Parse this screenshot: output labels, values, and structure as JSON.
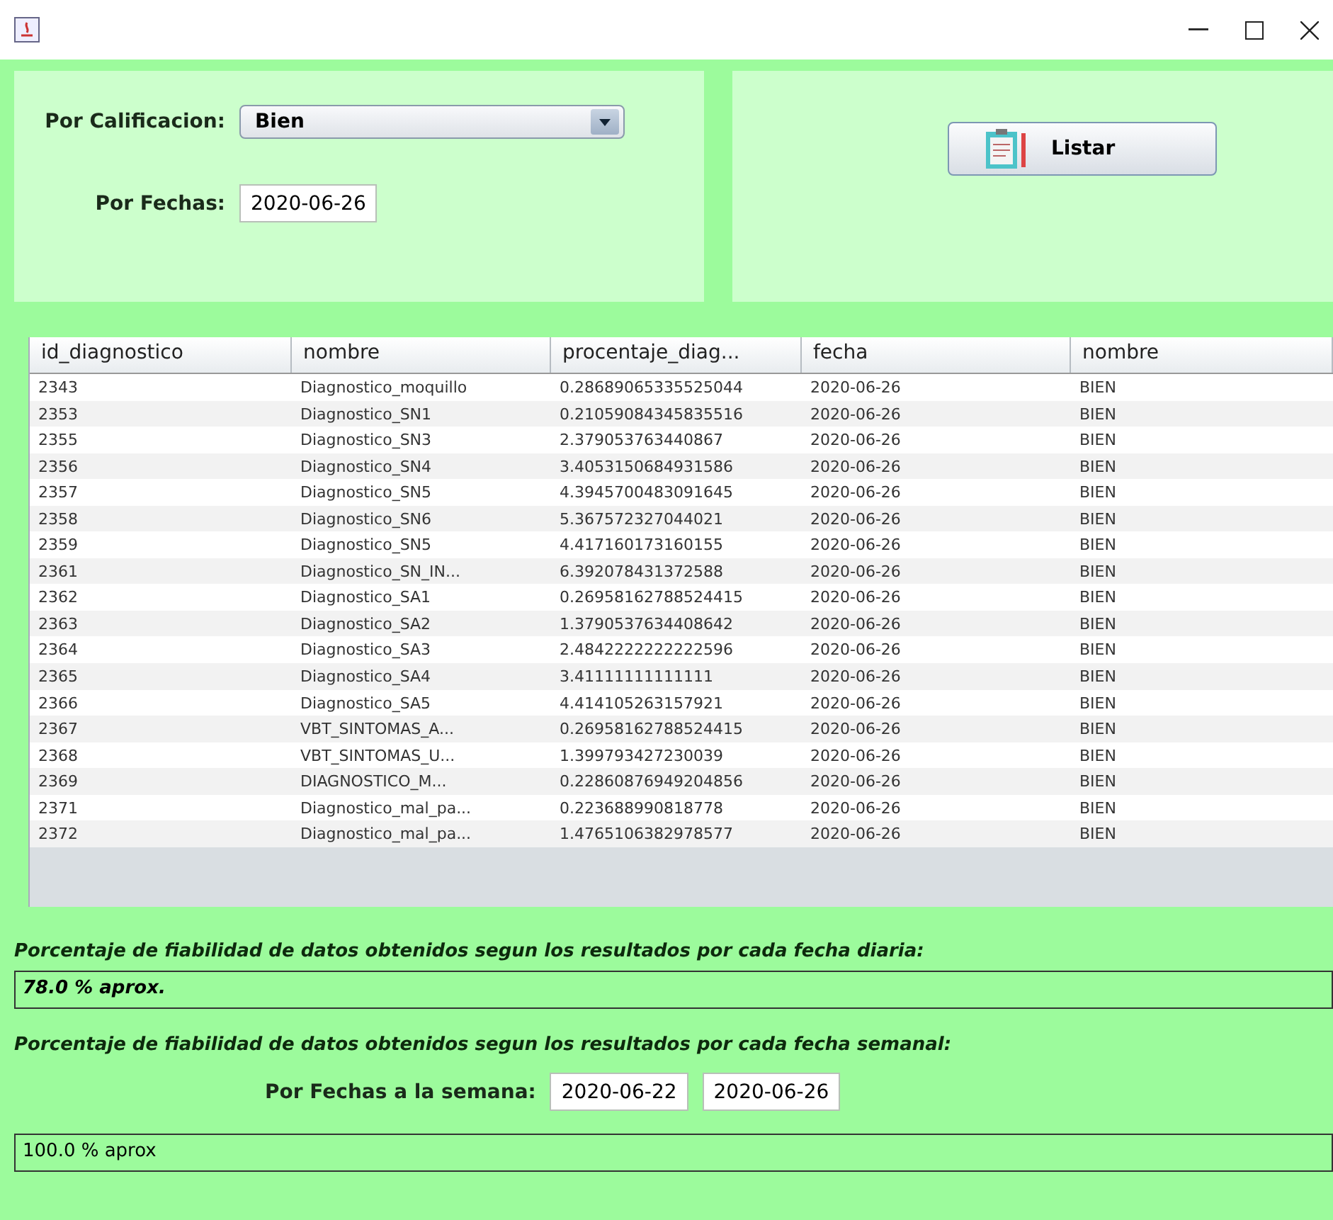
{
  "filter": {
    "grade_label": "Por Calificacion:",
    "grade_value": "Bien",
    "date_label": "Por Fechas:",
    "date_value": "2020-06-26"
  },
  "list_button": "Listar",
  "table": {
    "columns": [
      "id_diagnostico",
      "nombre",
      "procentaje_diag...",
      "fecha",
      "nombre"
    ],
    "rows": [
      [
        "2343",
        "Diagnostico_moquillo",
        "0.28689065335525044",
        "2020-06-26",
        "BIEN"
      ],
      [
        "2353",
        "Diagnostico_SN1",
        "0.21059084345835516",
        "2020-06-26",
        "BIEN"
      ],
      [
        "2355",
        "Diagnostico_SN3",
        "2.379053763440867",
        "2020-06-26",
        "BIEN"
      ],
      [
        "2356",
        "Diagnostico_SN4",
        "3.4053150684931586",
        "2020-06-26",
        "BIEN"
      ],
      [
        "2357",
        "Diagnostico_SN5",
        "4.3945700483091645",
        "2020-06-26",
        "BIEN"
      ],
      [
        "2358",
        "Diagnostico_SN6",
        "5.367572327044021",
        "2020-06-26",
        "BIEN"
      ],
      [
        "2359",
        "Diagnostico_SN5",
        "4.417160173160155",
        "2020-06-26",
        "BIEN"
      ],
      [
        "2361",
        "Diagnostico_SN_IN...",
        "6.392078431372588",
        "2020-06-26",
        "BIEN"
      ],
      [
        "2362",
        "Diagnostico_SA1",
        "0.26958162788524415",
        "2020-06-26",
        "BIEN"
      ],
      [
        "2363",
        "Diagnostico_SA2",
        "1.3790537634408642",
        "2020-06-26",
        "BIEN"
      ],
      [
        "2364",
        "Diagnostico_SA3",
        "2.4842222222222596",
        "2020-06-26",
        "BIEN"
      ],
      [
        "2365",
        "Diagnostico_SA4",
        "3.41111111111111",
        "2020-06-26",
        "BIEN"
      ],
      [
        "2366",
        "Diagnostico_SA5",
        "4.414105263157921",
        "2020-06-26",
        "BIEN"
      ],
      [
        "2367",
        "VBT_SINTOMAS_A...",
        "0.26958162788524415",
        "2020-06-26",
        "BIEN"
      ],
      [
        "2368",
        "VBT_SINTOMAS_U...",
        "1.399793427230039",
        "2020-06-26",
        "BIEN"
      ],
      [
        "2369",
        "DIAGNOSTICO_M...",
        "0.22860876949204856",
        "2020-06-26",
        "BIEN"
      ],
      [
        "2371",
        "Diagnostico_mal_pa...",
        "0.223688990818778",
        "2020-06-26",
        "BIEN"
      ],
      [
        "2372",
        "Diagnostico_mal_pa...",
        "1.4765106382978577",
        "2020-06-26",
        "BIEN"
      ]
    ]
  },
  "daily": {
    "label": "Porcentaje de fiabilidad de datos obtenidos segun los resultados por cada fecha diaria:",
    "value": "78.0 %  aprox."
  },
  "weekly": {
    "label": "Porcentaje de fiabilidad de datos obtenidos segun los resultados por cada fecha semanal:",
    "range_label": "Por Fechas a la semana:",
    "from": "2020-06-22",
    "to": "2020-06-26",
    "value": "100.0 %  aprox"
  }
}
